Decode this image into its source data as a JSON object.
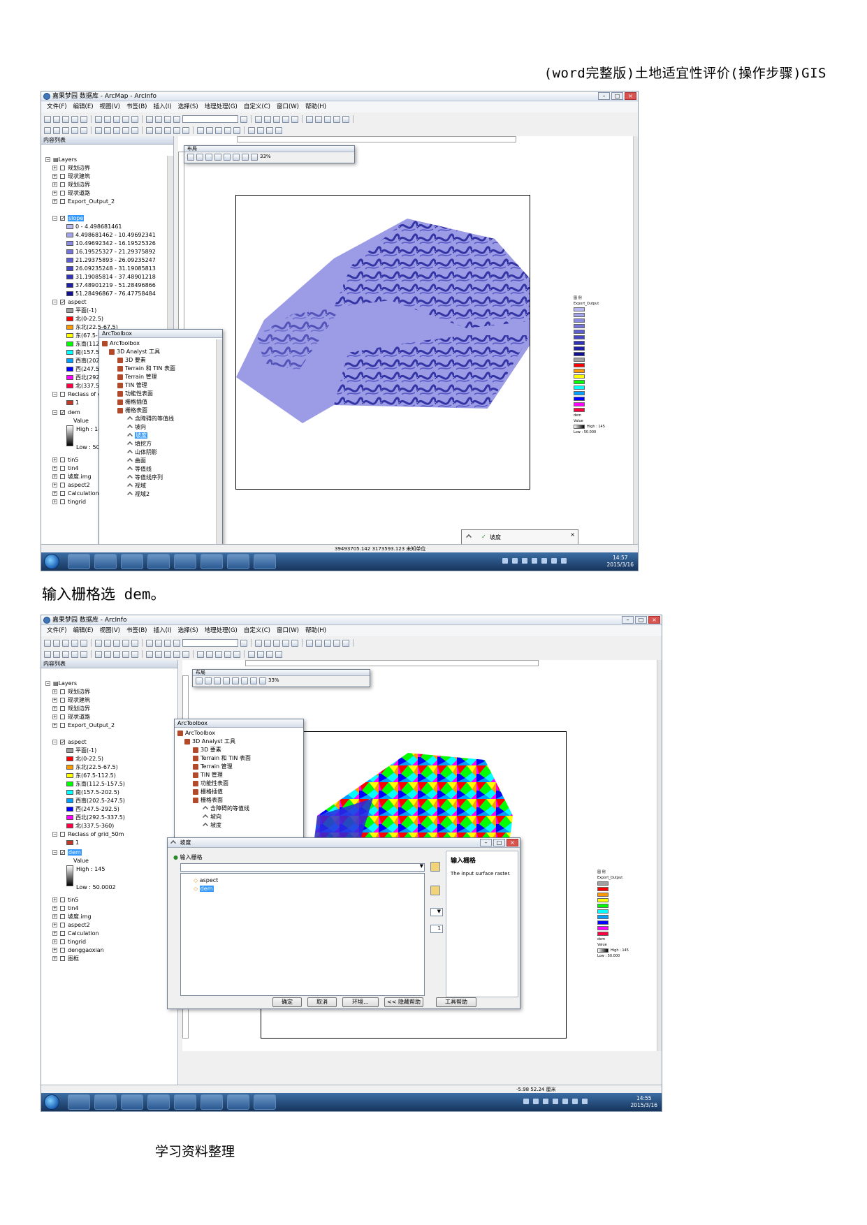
{
  "doc": {
    "header": "(word完整版)土地适宜性评价(操作步骤)GIS",
    "caption": "输入栅格选 dem。",
    "footer": "学习资料整理"
  },
  "shot1": {
    "title": "嘉果梦园 数据库 - ArcMap - ArcInfo",
    "menu": [
      "文件(F)",
      "编辑(E)",
      "视图(V)",
      "书签(B)",
      "插入(I)",
      "选择(S)",
      "地理处理(G)",
      "自定义(C)",
      "窗口(W)",
      "帮助(H)"
    ],
    "toc_title": "内容列表",
    "layers_label": "Layers",
    "layers": [
      "规划边界",
      "现状建筑",
      "规划边界",
      "现状道路",
      "Export_Output_2"
    ],
    "slope_label": "slope",
    "slope_classes": [
      "0 - 4.498681461",
      "4.498681462 - 10.49692341",
      "10.49692342 - 16.19525326",
      "16.19525327 - 21.29375892",
      "21.29375893 - 26.09235247",
      "26.09235248 - 31.19085813",
      "31.19085814 - 37.48901218",
      "37.48901219 - 51.28496866",
      "51.28496867 - 76.47758484"
    ],
    "aspect_label": "aspect",
    "aspect_classes": [
      "平面(-1)",
      "北(0-22.5)",
      "东北(22.5-67.5)",
      "东(67.5-112.5)",
      "东南(112.5-",
      "南(157.5-2",
      "西南(202.5-",
      "西(247.5-29",
      "西北(292.5-",
      "北(337.5-36"
    ],
    "reclass_label": "Reclass of gr",
    "reclass_value": "1",
    "dem_label": "dem",
    "dem_value": "Value",
    "dem_high": "High : 145",
    "dem_low": "Low : 50.00",
    "other_layers": [
      "tin5",
      "tin4",
      "坡度.img",
      "aspect2",
      "Calculation",
      "tingrid"
    ],
    "layout_title": "布局",
    "zoom": "33%",
    "toolbox_title": "ArcToolbox",
    "toolbox_root": "ArcToolbox",
    "toolbox_3d": "3D Analyst 工具",
    "toolbox_items": [
      "3D 要素",
      "Terrain 和 TIN 表面",
      "Terrain 管理",
      "TIN 管理",
      "功能性表面",
      "栅格插值",
      "栅格表面"
    ],
    "surface_tools": [
      "含障碍的等值线",
      "坡向",
      "坡度",
      "填挖方",
      "山体阴影",
      "曲面",
      "等值线",
      "等值线序列",
      "视域",
      "视域2"
    ],
    "legend_title": "图 例",
    "legend_sub": "Export_Output",
    "legend_dem": "dem",
    "legend_value": "Value",
    "legend_high": "High : 145",
    "legend_low": "Low : 50.000",
    "status_coords": "39493705.142  3173593.123 未知单位",
    "toast_text": "坡度",
    "clock_time": "14:57",
    "clock_date": "2015/3/16"
  },
  "shot2": {
    "title": "嘉果梦园 数据库 - ArcInfo",
    "menu": [
      "文件(F)",
      "编辑(E)",
      "视图(V)",
      "书签(B)",
      "插入(I)",
      "选择(S)",
      "地理处理(G)",
      "自定义(C)",
      "窗口(W)",
      "帮助(H)"
    ],
    "toc_title": "内容列表",
    "layers_label": "Layers",
    "layers": [
      "规划边界",
      "现状建筑",
      "规划边界",
      "现状道路",
      "Export_Output_2"
    ],
    "aspect_label": "aspect",
    "aspect_classes": [
      "平面(-1)",
      "北(0-22.5)",
      "东北(22.5-67.5)",
      "东(67.5-112.5)",
      "东南(112.5-157.5)",
      "南(157.5-202.5)",
      "西南(202.5-247.5)",
      "西(247.5-292.5)",
      "西北(292.5-337.5)",
      "北(337.5-360)"
    ],
    "reclass_label": "Reclass of grid_50m",
    "reclass_value": "1",
    "dem_label": "dem",
    "dem_value": "Value",
    "dem_high": "High : 145",
    "dem_low": "Low : 50.0002",
    "other_layers": [
      "tin5",
      "tin4",
      "坡度.img",
      "aspect2",
      "Calculation",
      "tingrid",
      "denggaoxian",
      "图框"
    ],
    "layout_title": "布局",
    "zoom": "33%",
    "toolbox_title": "ArcToolbox",
    "toolbox_root": "ArcToolbox",
    "toolbox_3d": "3D Analyst 工具",
    "toolbox_items": [
      "3D 要素",
      "Terrain 和 TIN 表面",
      "Terrain 管理",
      "TIN 管理",
      "功能性表面",
      "栅格插值",
      "栅格表面"
    ],
    "surface_tools": [
      "含障碍的等值线",
      "坡向",
      "坡度"
    ],
    "dialog_title": "坡度",
    "input_label": "输入栅格",
    "drop_items": [
      "aspect",
      "dem"
    ],
    "side_value": "1",
    "help_title": "输入栅格",
    "help_text": "The input surface raster.",
    "buttons": [
      "确定",
      "取消",
      "环境...",
      "<< 隐藏帮助",
      "工具帮助"
    ],
    "legend_title": "图 例",
    "legend_sub": "Export_Output",
    "legend_dem": "dem",
    "legend_value": "Value",
    "legend_high": "High : 145",
    "legend_low": "Low : 50.000",
    "status_coords": "-5.98  52.24 厘米",
    "clock_time": "14:55",
    "clock_date": "2015/3/16"
  },
  "colors": {
    "slope_ramp": [
      "#b9b9f2",
      "#a3a3ea",
      "#8b8be2",
      "#7575d9",
      "#5e5ed0",
      "#4747c5",
      "#3232b8",
      "#1f1fa6",
      "#101090"
    ],
    "aspect_ramp": [
      "#a0a0a0",
      "#ff0000",
      "#ff9900",
      "#ffff00",
      "#00ff00",
      "#00ffff",
      "#00a0ff",
      "#0000ff",
      "#ff00ff",
      "#ff0044"
    ]
  }
}
